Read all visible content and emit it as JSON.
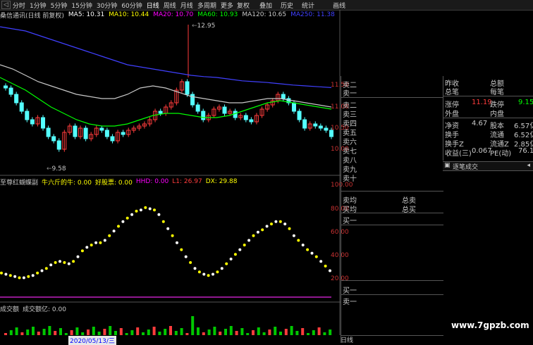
{
  "toolbar": {
    "items": [
      "分时",
      "1分钟",
      "5分钟",
      "15分钟",
      "30分钟",
      "60分钟",
      "日线",
      "周线",
      "月线",
      "多周期",
      "更多"
    ],
    "active_index": 6,
    "right_items": [
      "复权",
      "叠加",
      "历史",
      "统计",
      "画线"
    ]
  },
  "price_legend": {
    "name": "桑信通讯(日线 前复权)",
    "ma5": "MA5: 10.31",
    "ma10": "MA10: 10.44",
    "ma20": "MA20: 10.70",
    "ma60": "MA60: 10.93",
    "ma120": "MA120: 10.65",
    "ma250": "MA250: 11.38"
  },
  "price_axis": {
    "labels": [
      "11.50",
      "11.00",
      "10.50",
      "10.00"
    ]
  },
  "price_annotations": {
    "high": "12.95",
    "low": "9.58"
  },
  "indicator_legend": {
    "name": "至尊红蝴蝶副",
    "a": "牛六斤的牛: 0.00",
    "b": "好股票: 0.00",
    "c": "HHD: 0.00",
    "d": "L1: 26.97",
    "e": "DX: 29.88"
  },
  "indicator_axis": {
    "labels": [
      "100.00",
      "80.00",
      "60.00",
      "40.00",
      "20.00"
    ]
  },
  "volume_legend": {
    "name": "成交额",
    "value": "成交额亿: 0.00"
  },
  "order_book": {
    "sell": [
      "卖二",
      "卖一",
      "卖二",
      "卖三",
      "卖四",
      "卖五",
      "卖六",
      "卖七",
      "卖八",
      "卖九",
      "卖十"
    ],
    "avg_sell": "卖均",
    "avg_buy": "买均",
    "total_sell": "总卖",
    "total_buy": "总买",
    "buy_one": "买一",
    "buy_one_b": "买一",
    "sell_one_b": "卖一"
  },
  "stats": {
    "zuoshou": "昨收",
    "zonge": "总额",
    "zongbi": "总笔",
    "meibi": "每笔",
    "zhangting_l": "涨停",
    "zhangting_v": "11.19",
    "dieting_l": "跌停",
    "dieting_v": "9.15",
    "waipan": "外盘",
    "neipan": "内盘",
    "jingzi_l": "净资",
    "jingzi_v": "4.67",
    "guben_l": "股本",
    "guben_v": "6.57亿",
    "huanshou_l": "换手",
    "liutong_l": "流通",
    "liutong_v": "6.52亿",
    "huanshouz_l": "换手Z",
    "liutongz_l": "流通Z",
    "liutongz_v": "2.85亿",
    "shouyi_l": "收益(三)",
    "shouyi_v": "0.067",
    "pe_l": "PE(动)",
    "pe_v": "76.1"
  },
  "ticks_header": "逐笔成交",
  "bottom_tab": "日线",
  "date_label": "2020/05/13/三",
  "watermark": "www.7gpzb.com",
  "colors": {
    "ma5": "#ffffff",
    "ma10": "#ffff00",
    "ma20": "#ff00ff",
    "ma60": "#00ff00",
    "ma120": "#c8c8c8",
    "ma250": "#4040ff",
    "up": "#ff3c3c",
    "down": "#54ffff",
    "dots": "#ffff00"
  },
  "chart_data": [
    {
      "type": "line",
      "title": "",
      "ylim": [
        9.5,
        13.0
      ],
      "series_note_values": "approximate closes",
      "series": [
        {
          "name": "MA250",
          "values": [
            12.9,
            12.85,
            12.8,
            12.7,
            12.6,
            12.5,
            12.4,
            12.3,
            12.2,
            12.1,
            12.0,
            11.95,
            11.9,
            11.85,
            11.8,
            11.75,
            11.72,
            11.7,
            11.66,
            11.62,
            11.6,
            11.58,
            11.55,
            11.52,
            11.5,
            11.48,
            11.46
          ]
        },
        {
          "name": "MA120",
          "values": [
            12.0,
            11.9,
            11.75,
            11.6,
            11.5,
            11.4,
            11.3,
            11.25,
            11.2,
            11.2,
            11.3,
            11.45,
            11.5,
            11.45,
            11.35,
            11.25,
            11.2,
            11.15,
            11.1,
            11.1,
            11.15,
            11.2,
            11.2,
            11.15,
            11.1,
            11.05,
            11.0
          ]
        },
        {
          "name": "MA60",
          "values": [
            11.7,
            11.55,
            11.4,
            11.2,
            11.0,
            10.85,
            10.7,
            10.6,
            10.55,
            10.55,
            10.6,
            10.7,
            10.8,
            10.85,
            10.85,
            10.8,
            10.75,
            10.75,
            10.8,
            10.9,
            11.0,
            11.1,
            11.15,
            11.1,
            11.05,
            11.0,
            10.95
          ]
        }
      ]
    },
    {
      "type": "line",
      "ylim": [
        0,
        100
      ],
      "series": [
        {
          "values": [
            26,
            25,
            24,
            23,
            22,
            22,
            23,
            24,
            26,
            28,
            30,
            33,
            35,
            36,
            35,
            34,
            36,
            40,
            45,
            48,
            50,
            52,
            52,
            54,
            58,
            62,
            66,
            70,
            73,
            76,
            79,
            80,
            82,
            81,
            80,
            76,
            70,
            64,
            58,
            52,
            46,
            40,
            35,
            30,
            27,
            25,
            24,
            25,
            27,
            30,
            34,
            38,
            42,
            46,
            50,
            54,
            58,
            61,
            63,
            66,
            68,
            70,
            70,
            68,
            64,
            58,
            54,
            50,
            46,
            43,
            40,
            36,
            32,
            28
          ]
        }
      ]
    }
  ]
}
